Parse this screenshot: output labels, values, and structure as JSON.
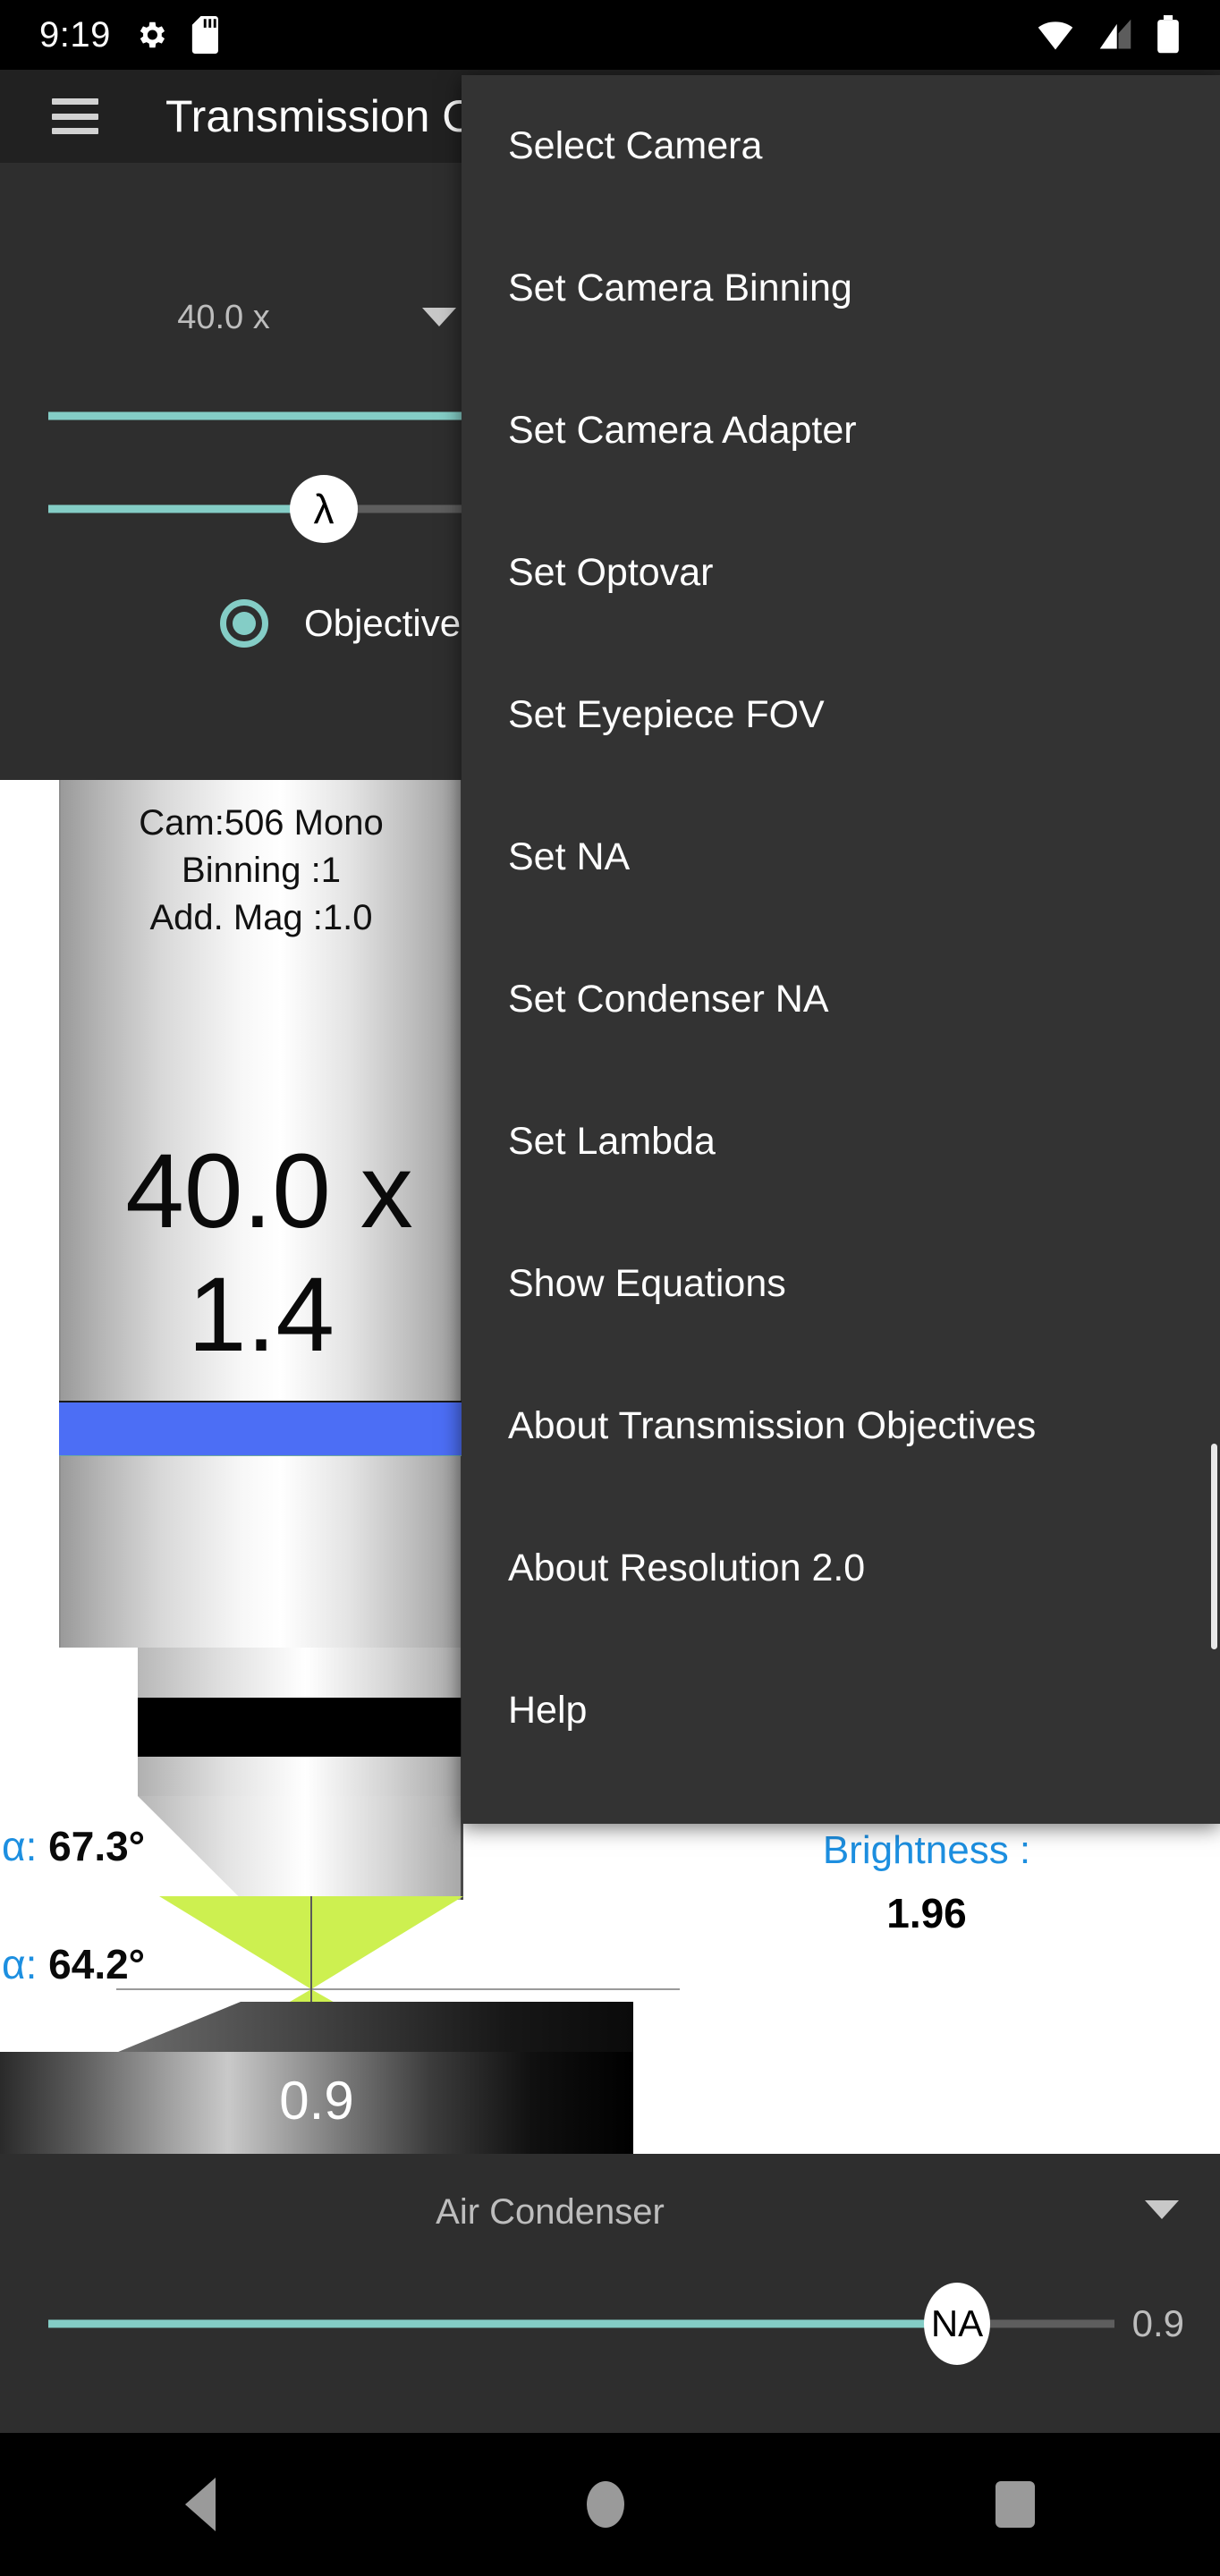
{
  "statusbar": {
    "time": "9:19",
    "icons_left": [
      "gear-icon",
      "sd-card-icon"
    ],
    "icons_right": [
      "wifi-icon",
      "cellular-signal-icon",
      "battery-icon"
    ]
  },
  "appbar": {
    "menu_icon": "hamburger-menu-icon",
    "title": "Transmission Objectives"
  },
  "controls": {
    "magnification": "40.0 x",
    "dropdown_icon": "chevron-down-icon",
    "slider_top": {
      "thumb_label": "",
      "fill_percent": 100
    },
    "slider_lambda": {
      "thumb_label": "λ",
      "fill_percent": 70
    },
    "radio": {
      "label": "Objective",
      "selected": true
    }
  },
  "diagram": {
    "camera_lines": [
      "Cam:506 Mono",
      "Binning :1",
      "Add. Mag :1.0"
    ],
    "objective_mag": "40.0 x",
    "objective_na": "1.4",
    "alpha_top_prefix": "α: ",
    "alpha_top": "67.3°",
    "alpha_bottom_prefix": "α: ",
    "alpha_bottom": "64.2°",
    "condenser_na_label": "0.9",
    "brightness_label": "Brightness :",
    "brightness_value": "1.96"
  },
  "bottom": {
    "condenser_name": "Air Condenser",
    "dropdown_icon": "chevron-down-icon",
    "na_slider": {
      "thumb_label": "NA",
      "value": "0.9",
      "fill_percent": 93
    }
  },
  "navbar": {
    "back": "back-triangle-icon",
    "home": "home-circle-icon",
    "recents": "recents-square-icon"
  },
  "menu": {
    "items": [
      {
        "label": "Select Camera"
      },
      {
        "label": "Set Camera Binning"
      },
      {
        "label": "Set Camera Adapter"
      },
      {
        "label": "Set Optovar"
      },
      {
        "label": "Set Eyepiece FOV"
      },
      {
        "label": "Set NA"
      },
      {
        "label": "Set Condenser NA"
      },
      {
        "label": "Set Lambda"
      },
      {
        "label": "Show Equations"
      },
      {
        "label": "About Transmission Objectives"
      },
      {
        "label": "About Resolution 2.0"
      },
      {
        "label": "Help"
      }
    ]
  },
  "colors": {
    "accent_teal": "#84cdc6",
    "accent_blue": "#1d8fe0",
    "band_blue": "#4c6ef5",
    "cone_green": "#cdf050",
    "appbar_bg": "#212121",
    "panel_bg": "#2e2e2e",
    "menu_bg": "#333333"
  }
}
